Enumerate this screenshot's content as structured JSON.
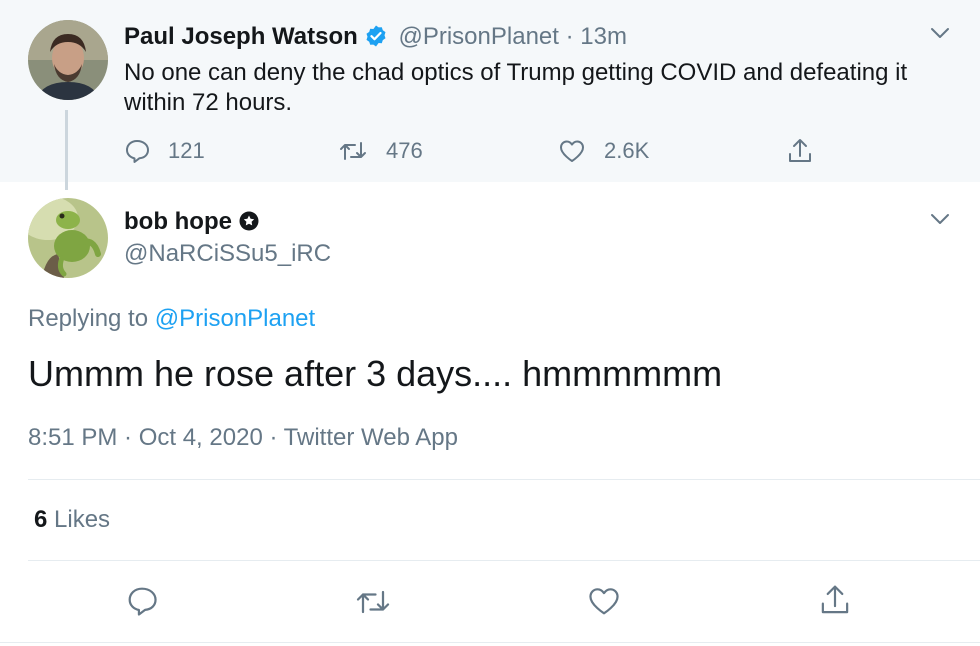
{
  "parent_tweet": {
    "author_name": "Paul Joseph Watson",
    "handle": "@PrisonPlanet",
    "separator": "·",
    "time": "13m",
    "text": "No one can deny the chad optics of Trump getting COVID and defeating it within 72 hours.",
    "reply_count": "121",
    "retweet_count": "476",
    "like_count": "2.6K",
    "verified": true
  },
  "reply_tweet": {
    "author_name": "bob hope",
    "handle": "@NaRCiSSu5_iRC",
    "replying_prefix": "Replying to ",
    "replying_to": "@PrisonPlanet",
    "text": "Ummm he rose after 3 days.... hmmmmmm",
    "meta": "8:51 PM · Oct 4, 2020 · Twitter Web App",
    "likes_count": "6",
    "likes_label": " Likes"
  },
  "icons": {
    "reply": "reply-icon",
    "retweet": "retweet-icon",
    "like": "heart-icon",
    "share": "share-icon",
    "menu": "chevron-down-icon",
    "verified": "verified-badge-icon",
    "badge": "gear-badge-icon"
  },
  "colors": {
    "accent": "#1da1f2",
    "muted": "#657786",
    "text": "#14171a",
    "parent_bg": "#f5f8fa"
  }
}
